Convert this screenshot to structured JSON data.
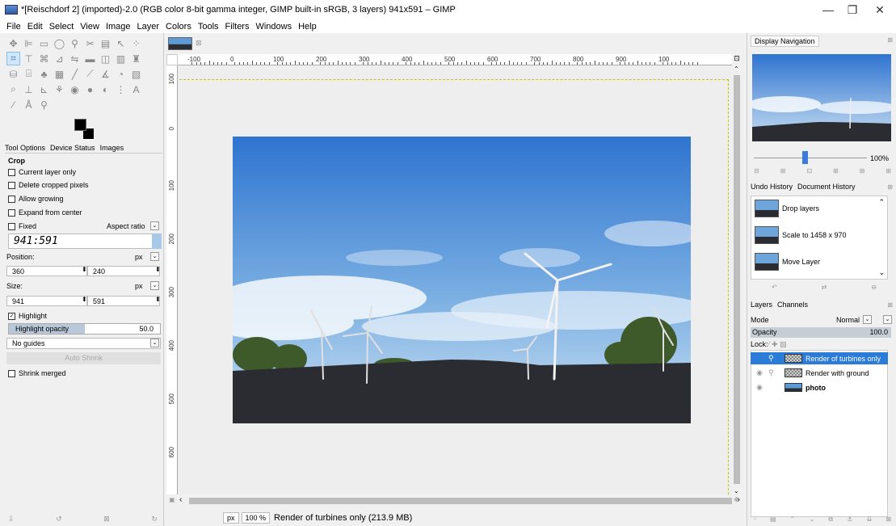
{
  "window": {
    "title": "*[Reischdorf 2] (imported)-2.0 (RGB color 8-bit gamma integer, GIMP built-in sRGB, 3 layers) 941x591 – GIMP",
    "minimize": "—",
    "restore": "❐",
    "close": "✕"
  },
  "menu": [
    "File",
    "Edit",
    "Select",
    "View",
    "Image",
    "Layer",
    "Colors",
    "Tools",
    "Filters",
    "Windows",
    "Help"
  ],
  "left_tabs": [
    "Tool Options",
    "Device Status",
    "Images"
  ],
  "tool_options": {
    "tool_name": "Crop",
    "current_layer_only": "Current layer only",
    "delete_cropped_pixels": "Delete cropped pixels",
    "allow_growing": "Allow growing",
    "expand_from_center": "Expand from center",
    "fixed": "Fixed",
    "aspect_ratio": "Aspect ratio",
    "ratio_value": "941:591",
    "position_label": "Position:",
    "position_unit": "px",
    "position_x": "360",
    "position_y": "240",
    "size_label": "Size:",
    "size_unit": "px",
    "size_w": "941",
    "size_h": "591",
    "highlight": "Highlight",
    "highlight_opacity_label": "Highlight opacity",
    "highlight_opacity_value": "50.0",
    "highlight_opacity_fraction": 0.5,
    "guides": "No guides",
    "auto_shrink": "Auto Shrink",
    "shrink_merged": "Shrink merged"
  },
  "ruler": {
    "h_labels": [
      "-100",
      "0",
      "100",
      "200",
      "300",
      "400",
      "500",
      "600",
      "700",
      "800",
      "900",
      "100"
    ],
    "v_labels": [
      "100",
      "0",
      "100",
      "200",
      "300",
      "400",
      "500",
      "600",
      "700"
    ]
  },
  "status": {
    "unit": "px",
    "zoom": "100 %",
    "message": "Render of turbines only (213.9 MB)"
  },
  "navigation": {
    "title": "Display Navigation",
    "zoom": "100%"
  },
  "history_tabs": [
    "Undo History",
    "Document History"
  ],
  "history": [
    "Drop layers",
    "Scale to 1458 x 970",
    "Move Layer"
  ],
  "layers_tabs": [
    "Layers",
    "Channels"
  ],
  "layers_panel": {
    "mode_label": "Mode",
    "mode_value": "Normal",
    "opacity_label": "Opacity",
    "opacity_value": "100.0",
    "lock_label": "Lock:"
  },
  "layers": [
    {
      "name": "Render of turbines only",
      "selected": true
    },
    {
      "name": "Render with ground",
      "selected": false
    },
    {
      "name": "photo",
      "selected": false
    }
  ],
  "colors": {
    "accent": "#2b7cd9",
    "sky": "#4d8fd6",
    "ground": "#2a2c31"
  }
}
